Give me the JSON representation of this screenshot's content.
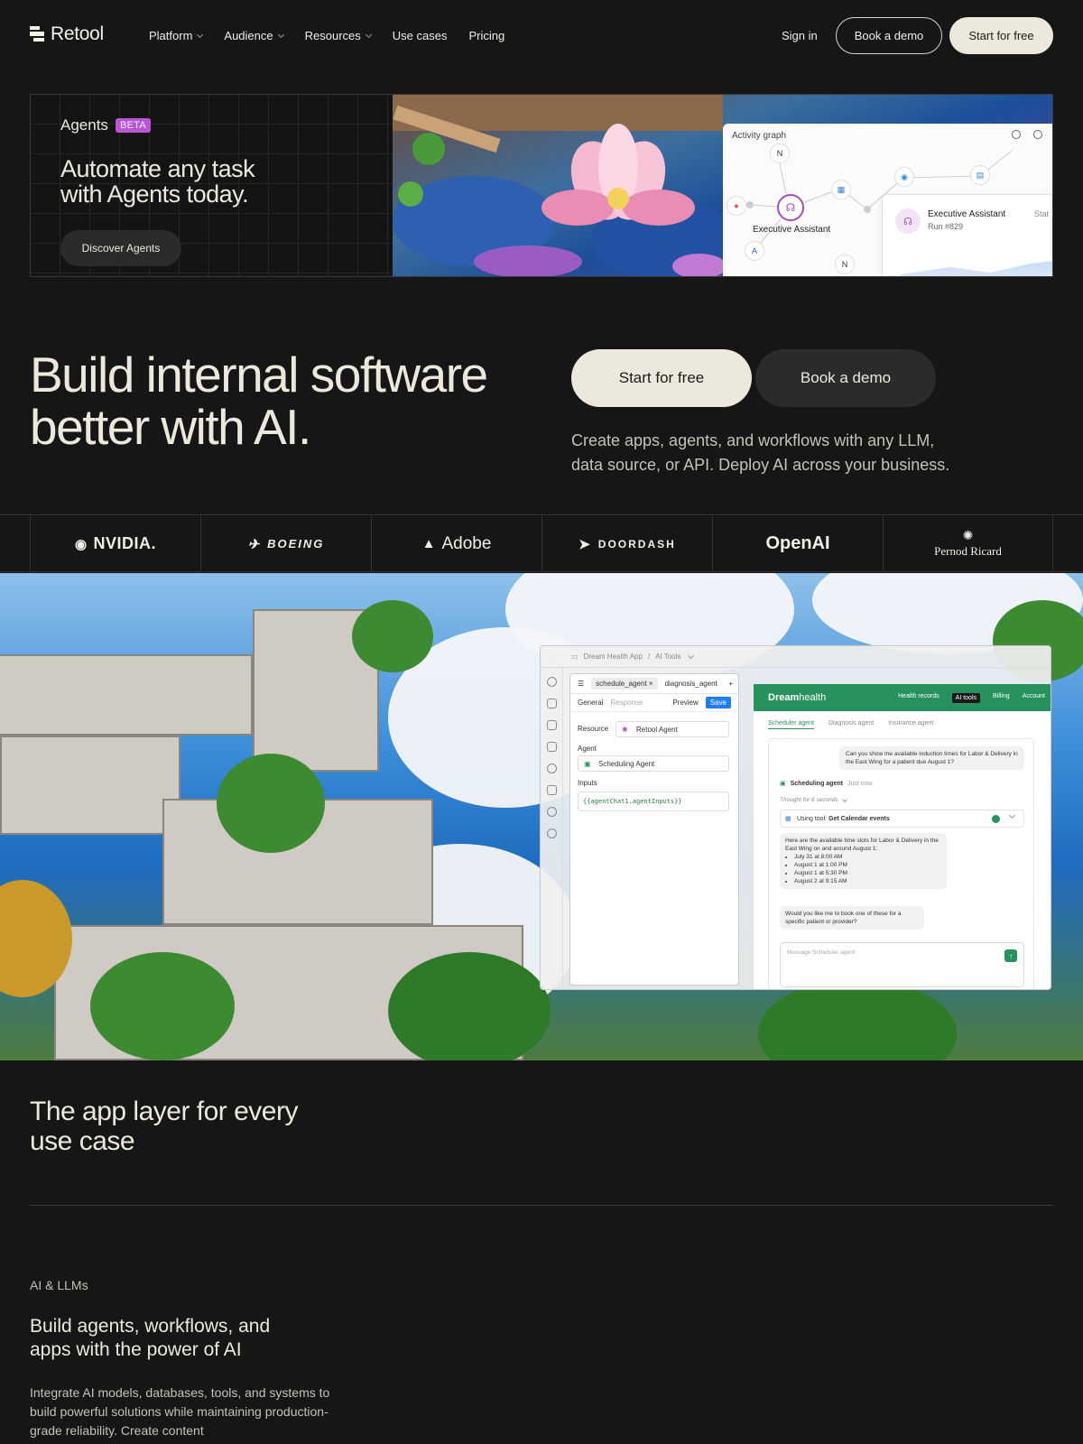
{
  "nav": {
    "brand": "Retool",
    "links": [
      {
        "label": "Platform",
        "dropdown": true
      },
      {
        "label": "Audience",
        "dropdown": true
      },
      {
        "label": "Resources",
        "dropdown": true
      },
      {
        "label": "Use cases",
        "dropdown": false
      },
      {
        "label": "Pricing",
        "dropdown": false
      }
    ],
    "sign_in": "Sign in",
    "book_demo": "Book a demo",
    "start_free": "Start for free"
  },
  "banner": {
    "label": "Agents",
    "badge": "BETA",
    "title": "Automate any task with Agents today.",
    "cta": "Discover Agents",
    "activity_graph": {
      "title": "Activity graph",
      "node_label": "Executive Assistant",
      "card_name": "Executive Assistant",
      "card_run": "Run #829",
      "card_status": "Stat"
    }
  },
  "hero": {
    "title": "Build internal software better with AI.",
    "primary_cta": "Start for free",
    "secondary_cta": "Book a demo",
    "subtitle": "Create apps, agents, and workflows with any LLM, data source, or API. Deploy AI across your business."
  },
  "logos": [
    "NVIDIA.",
    "BOEING",
    "Adobe",
    "DOORDASH",
    "OpenAI",
    "Pernod Ricard"
  ],
  "showcase": {
    "breadcrumb_app": "Dream Health App",
    "breadcrumb_sep": "/",
    "breadcrumb_page": "AI Tools",
    "inspector": {
      "tab_active": "schedule_agent",
      "tab_other": "diagnosis_agent",
      "sub_general": "General",
      "sub_response": "Response",
      "preview": "Preview",
      "save": "Save",
      "resource_label": "Resource",
      "resource_value": "Retool Agent",
      "agent_label": "Agent",
      "agent_value": "Scheduling Agent",
      "inputs_label": "Inputs",
      "inputs_value": "{{agentChat1.agentInputs}}"
    },
    "dreamhealth": {
      "brand_bold": "Dream",
      "brand_light": "health",
      "nav": [
        "Health records",
        "AI tools",
        "Billing",
        "Account"
      ],
      "active_nav": "AI tools",
      "tabs": [
        "Scheduler agent",
        "Diagnosis agent",
        "Insurance agent"
      ],
      "user_msg": "Can you show me available induction times for Labor & Delivery in the East Wing for a patient due August 1?",
      "agent_name": "Scheduling agent",
      "agent_time": "Just now",
      "thought": "Thought for 6 seconds",
      "tool_prefix": "Using tool:",
      "tool_name": "Get Calendar events",
      "agent_msg": "Here are the available time slots for Labor & Delivery in the East Wing on and around August 1:",
      "slots": [
        "July 31 at 8:00 AM",
        "August 1 at 1:00 PM",
        "August 1 at 5:30 PM",
        "August 2 at 9:15 AM"
      ],
      "agent_msg2": "Would you like me to book one of these for a specific patient or provider?",
      "input_placeholder": "Message Scheduler agent"
    }
  },
  "app_layer": {
    "title": "The app layer for every use case",
    "eyebrow": "AI & LLMs",
    "subtitle": "Build agents, workflows, and apps with the power of AI",
    "body": "Integrate AI models, databases, tools, and systems to build powerful solutions while maintaining production-grade reliability. Create content"
  }
}
